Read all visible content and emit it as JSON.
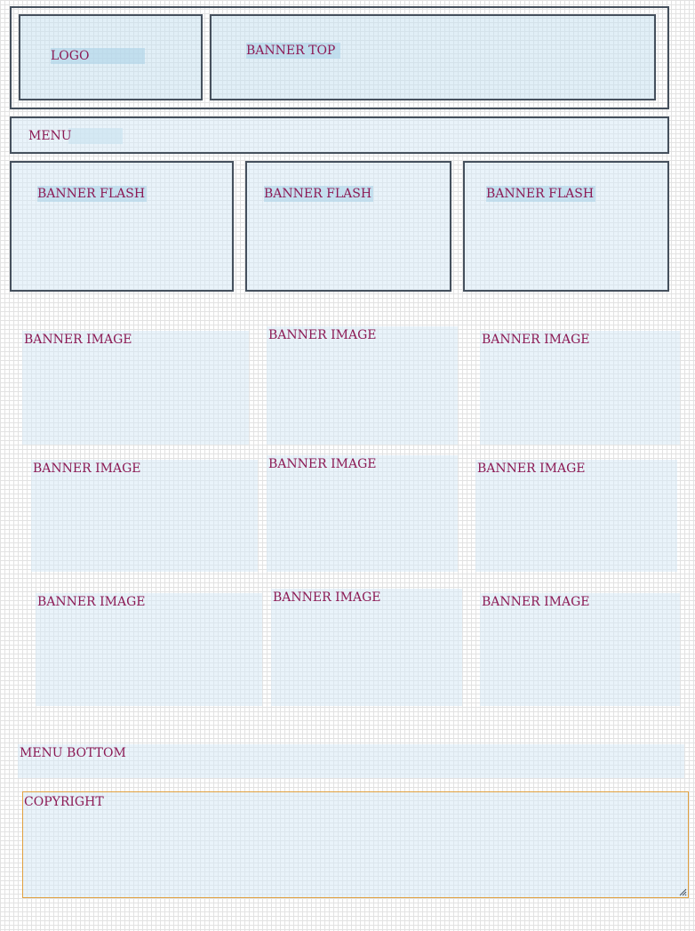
{
  "header": {
    "logo_label": "LOGO",
    "banner_top_label": "BANNER TOP"
  },
  "menu": {
    "label": "MENU"
  },
  "banner_flash": [
    {
      "label": "BANNER FLASH"
    },
    {
      "label": "BANNER FLASH"
    },
    {
      "label": "BANNER FLASH"
    }
  ],
  "banner_images": [
    {
      "label": "BANNER IMAGE"
    },
    {
      "label": "BANNER IMAGE"
    },
    {
      "label": "BANNER IMAGE"
    },
    {
      "label": "BANNER IMAGE"
    },
    {
      "label": "BANNER IMAGE"
    },
    {
      "label": "BANNER IMAGE"
    },
    {
      "label": "BANNER IMAGE"
    },
    {
      "label": "BANNER IMAGE"
    },
    {
      "label": "BANNER IMAGE"
    }
  ],
  "menu_bottom": {
    "label": "MENU BOTTOM"
  },
  "copyright": {
    "label": "COPYRIGHT"
  },
  "colors": {
    "border": "#45505d",
    "label": "#8c1a55",
    "copyright_border": "#e0a040",
    "box_fill": "#d7eaf6"
  }
}
